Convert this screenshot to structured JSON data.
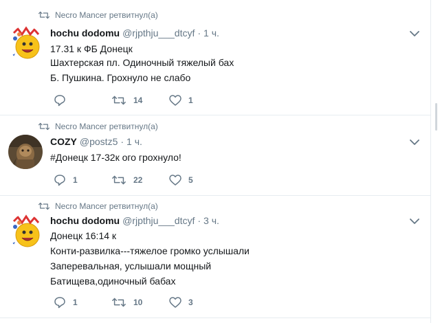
{
  "tweets": [
    {
      "retweeted_by": "Necro Mancer ретвитнул(а)",
      "name": "hochu dodomu",
      "handle": "@rjpthju___dtcyf",
      "time": "1 ч.",
      "avatar_icon": "smiley-crown-avatar",
      "lines": [
        "17.31 к ФБ Донецк",
        "Шахтерская пл. Одиночный тяжелый бах",
        "Б. Пушкина. Грохнуло не слабо"
      ],
      "replies": "",
      "retweets": "14",
      "likes": "1"
    },
    {
      "retweeted_by": "Necro Mancer ретвитнул(а)",
      "name": "COZY",
      "handle": "@postz5",
      "time": "1 ч.",
      "avatar_icon": "photo-avatar",
      "lines": [
        "#Донецк 17-32к ого грохнуло!"
      ],
      "replies": "1",
      "retweets": "22",
      "likes": "5"
    },
    {
      "retweeted_by": "Necro Mancer ретвитнул(а)",
      "name": "hochu dodomu",
      "handle": "@rjpthju___dtcyf",
      "time": "3 ч.",
      "avatar_icon": "smiley-crown-avatar",
      "lines": [
        "Донецк 16:14 к",
        "Конти-развилка---тяжелое громко услышали",
        "Заперевальная, услышали мощный",
        "Батищева,одиночный бабах"
      ],
      "replies": "1",
      "retweets": "10",
      "likes": "3"
    }
  ],
  "colors": {
    "text": "#14171a",
    "secondary": "#657786",
    "divider": "#e6ecf0"
  }
}
